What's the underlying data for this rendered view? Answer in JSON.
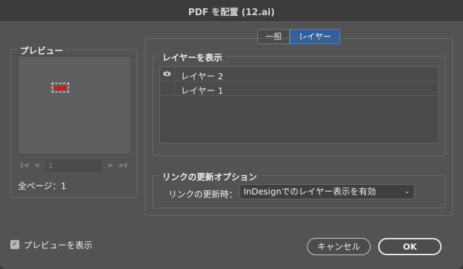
{
  "window": {
    "title": "PDF を配置 (12.ai)"
  },
  "preview": {
    "legend": "プレビュー",
    "page_value": "1",
    "total_pages": "全ページ：1",
    "thumbnail_color": "#c41e1e"
  },
  "tabs": [
    {
      "label": "一般",
      "active": false
    },
    {
      "label": "レイヤー",
      "active": true
    }
  ],
  "layers": {
    "legend": "レイヤーを表示",
    "items": [
      {
        "name": "レイヤー 2",
        "visible": true,
        "vis_icon": "eye-icon"
      },
      {
        "name": "レイヤー 1",
        "visible": false,
        "vis_icon": ""
      }
    ]
  },
  "link_options": {
    "legend": "リンクの更新オプション",
    "label": "リンクの更新時：",
    "selected": "InDesignでのレイヤー表示を有効"
  },
  "footer": {
    "show_preview_label": "プレビューを表示",
    "show_preview_checked": true,
    "cancel_label": "キャンセル",
    "ok_label": "OK"
  },
  "colors": {
    "accent": "#2f5f9e",
    "background": "#535353"
  }
}
